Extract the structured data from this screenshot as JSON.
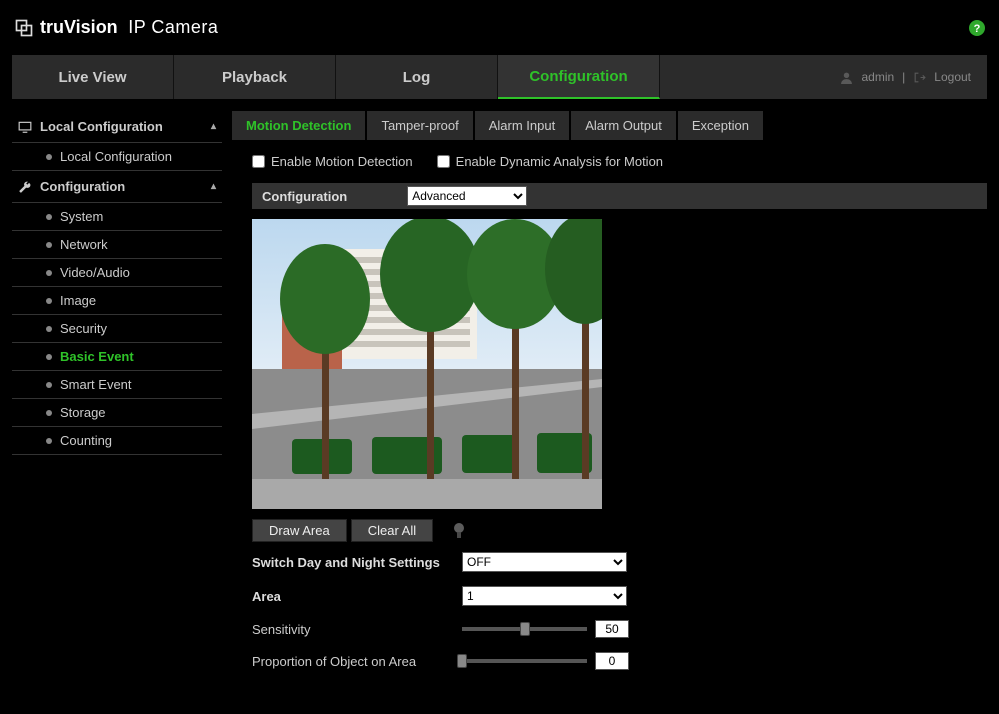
{
  "brand": {
    "mark": "truVision",
    "suffix": "IP Camera"
  },
  "nav": {
    "liveview": "Live View",
    "playback": "Playback",
    "log": "Log",
    "configuration": "Configuration"
  },
  "userbar": {
    "name": "admin",
    "logout": "Logout",
    "sep": "|"
  },
  "sidebar": {
    "group1": {
      "title": "Local Configuration",
      "items": [
        "Local Configuration"
      ]
    },
    "group2": {
      "title": "Configuration",
      "items": [
        "System",
        "Network",
        "Video/Audio",
        "Image",
        "Security",
        "Basic Event",
        "Smart Event",
        "Storage",
        "Counting"
      ],
      "activeIndex": 5
    }
  },
  "tabs": [
    "Motion Detection",
    "Tamper-proof",
    "Alarm Input",
    "Alarm Output",
    "Exception"
  ],
  "activeTab": 0,
  "checks": {
    "enableMotion": "Enable Motion Detection",
    "enableDynamic": "Enable Dynamic Analysis for Motion"
  },
  "cfgband": {
    "label": "Configuration",
    "value": "Advanced"
  },
  "buttons": {
    "draw": "Draw Area",
    "clear": "Clear All"
  },
  "rows": {
    "switch": {
      "label": "Switch Day and Night Settings",
      "value": "OFF"
    },
    "area": {
      "label": "Area",
      "value": "1"
    },
    "sensitivity": {
      "label": "Sensitivity",
      "value": "50",
      "pct": 50
    },
    "proportion": {
      "label": "Proportion of Object on Area",
      "value": "0",
      "pct": 0
    }
  }
}
